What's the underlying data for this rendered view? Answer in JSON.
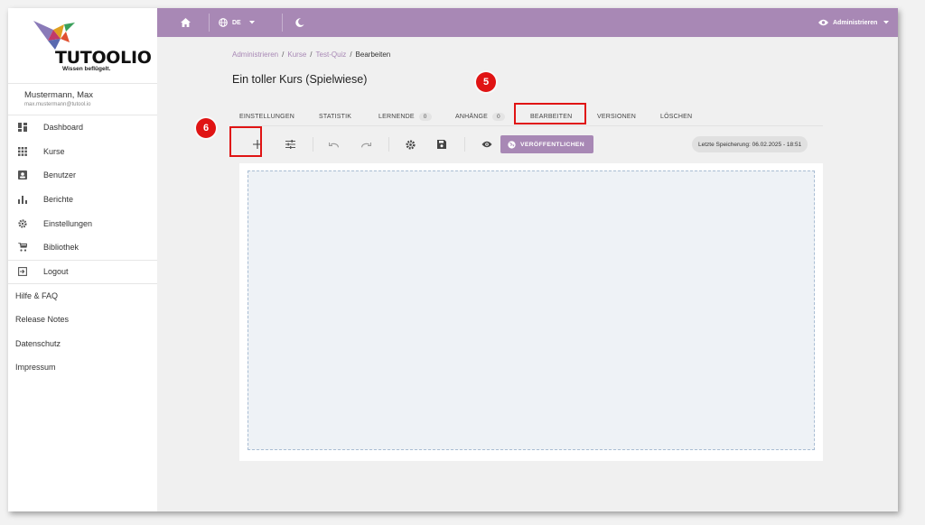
{
  "brand": {
    "name": "TUTOOLIO",
    "tagline": "Wissen beflügelt."
  },
  "user": {
    "name": "Mustermann, Max",
    "email": "max.mustermann@tutool.io"
  },
  "sidebar": {
    "items": [
      {
        "label": "Dashboard",
        "icon": "dashboard-icon"
      },
      {
        "label": "Kurse",
        "icon": "grid-icon"
      },
      {
        "label": "Benutzer",
        "icon": "user-icon"
      },
      {
        "label": "Berichte",
        "icon": "bar-chart-icon"
      },
      {
        "label": "Einstellungen",
        "icon": "gear-icon"
      },
      {
        "label": "Bibliothek",
        "icon": "cart-icon"
      },
      {
        "label": "Logout",
        "icon": "logout-icon"
      }
    ],
    "links": [
      "Hilfe & FAQ",
      "Release Notes",
      "Datenschutz",
      "Impressum"
    ]
  },
  "topbar": {
    "language": "DE",
    "admin_label": "Administrieren",
    "color": "#a888b5"
  },
  "breadcrumb": [
    "Administrieren",
    "Kurse",
    "Test-Quiz",
    "Bearbeiten"
  ],
  "page_title": "Ein toller Kurs (Spielwiese)",
  "tabs": [
    {
      "label": "EINSTELLUNGEN",
      "count": null
    },
    {
      "label": "STATISTIK",
      "count": null
    },
    {
      "label": "LERNENDE",
      "count": "0"
    },
    {
      "label": "ANHÄNGE",
      "count": "0"
    },
    {
      "label": "BEARBEITEN",
      "count": null
    },
    {
      "label": "VERSIONEN",
      "count": null
    },
    {
      "label": "LÖSCHEN",
      "count": null
    }
  ],
  "active_tab": "BEARBEITEN",
  "toolbar": {
    "publish_label": "VERÖFFENTLICHEN",
    "last_saved": "Letzte Speicherung: 06.02.2025 - 18:51"
  },
  "annotations": {
    "step5": "5",
    "step6": "6",
    "color": "#e01414"
  }
}
